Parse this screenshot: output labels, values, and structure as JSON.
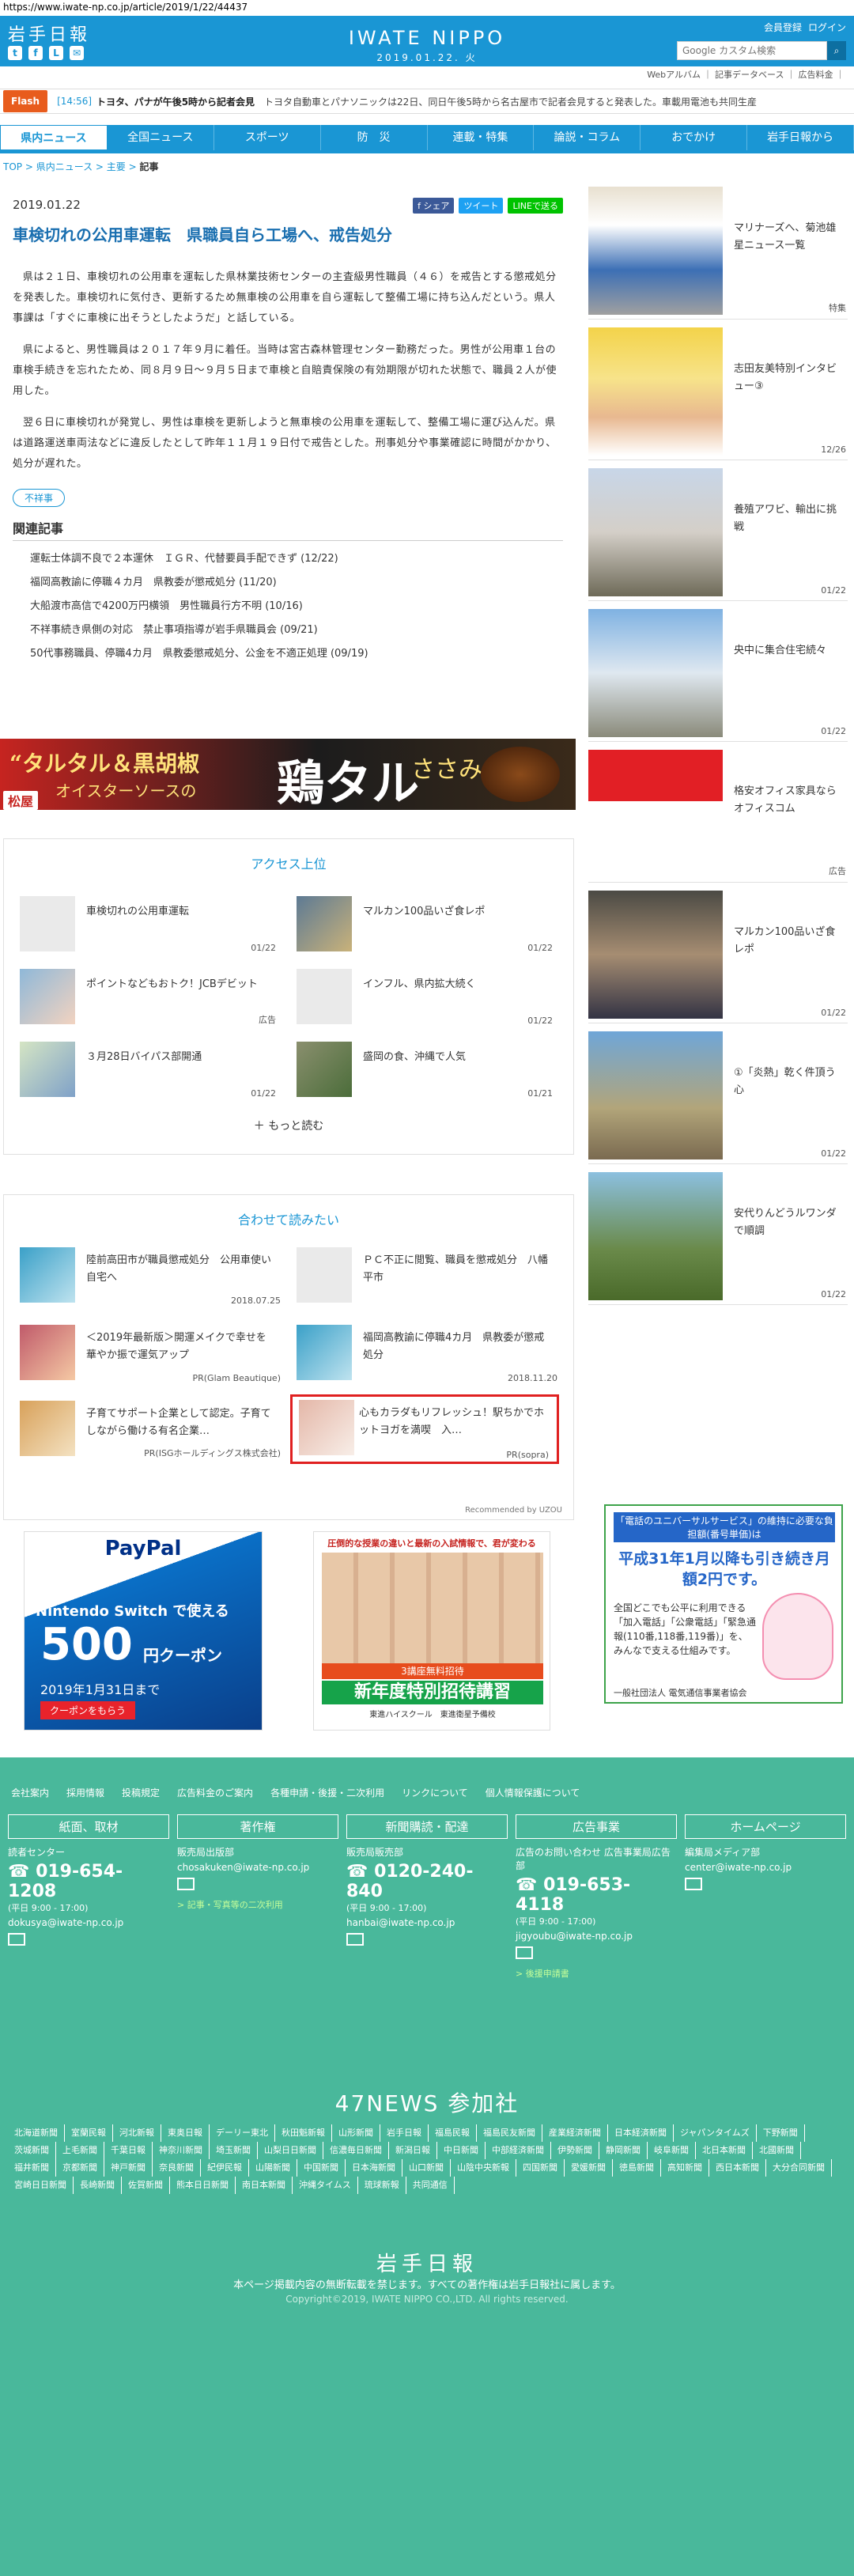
{
  "url": "https://www.iwate-np.co.jp/article/2019/1/22/44437",
  "header": {
    "logo": "岩手日報",
    "brand": "IWATE NIPPO",
    "date": "2019.01.22. 火",
    "links": [
      "会員登録",
      "ログイン"
    ],
    "search_placeholder": "Google カスタム検索",
    "subnav": "Webアルバム ｜ 記事データベース ｜ 広告料金 ｜"
  },
  "flash": {
    "label": "Flash",
    "time": "[14:56]",
    "headline": "トヨタ、パナが午後5時から記者会見",
    "text": "トヨタ自動車とパナソニックは22日、同日午後5時から名古屋市で記者会見すると発表した。車載用電池も共同生産"
  },
  "nav": [
    "県内ニュース",
    "全国ニュース",
    "スポーツ",
    "防　災",
    "連載・特集",
    "論説・コラム",
    "おでかけ",
    "岩手日報から"
  ],
  "breadcrumb": {
    "top": "TOP",
    "sep1": " > ",
    "cat": "県内ニュース",
    "sep2": " > ",
    "sub": "主要",
    "sep3": " > ",
    "current": "記事"
  },
  "article": {
    "date": "2019.01.22",
    "share": [
      "f シェア",
      "ツイート",
      "LINEで送る"
    ],
    "title": "車検切れの公用車運転　県職員自ら工場へ、戒告処分",
    "paragraphs": [
      "県は２１日、車検切れの公用車を運転した県林業技術センターの主査級男性職員（４６）を戒告とする懲戒処分を発表した。車検切れに気付き、更新するため無車検の公用車を自ら運転して整備工場に持ち込んだという。県人事課は「すぐに車検に出そうとしたようだ」と話している。",
      "県によると、男性職員は２０１７年９月に着任。当時は宮古森林管理センター勤務だった。男性が公用車１台の車検手続きを忘れたため、同８月９日～９月５日まで車検と自賠責保険の有効期限が切れた状態で、職員２人が使用した。",
      "翌６日に車検切れが発覚し、男性は車検を更新しようと無車検の公用車を運転して、整備工場に運び込んだ。県は道路運送車両法などに違反したとして昨年１１月１９日付で戒告とした。刑事処分や事業確認に時間がかかり、処分が遅れた。"
    ],
    "tag": "不祥事",
    "related_title": "関連記事",
    "related": [
      "運転士体調不良で２本運休　ＩＧＲ、代替要員手配できず (12/22)",
      "福岡高教諭に停職４カ月　県教委が懲戒処分 (11/20)",
      "大船渡市高信で4200万円横領　男性職員行方不明 (10/16)",
      "不祥事続き県側の対応　禁止事項指導が岩手県職員会 (09/21)",
      "50代事務職員、停職4カ月　県教委懲戒処分、公金を不適正処理 (09/19)"
    ]
  },
  "ad_banner": {
    "l1": "“タルタル＆黒胡椒",
    "l2": "オイスターソースの",
    "l3": "鶏タル",
    "l4": "ささみ",
    "brand": "松屋"
  },
  "access": {
    "title": "アクセス上位",
    "items": [
      {
        "text": "車検切れの公用車運転",
        "date": "01/22"
      },
      {
        "text": "マルカン100品いざ食レポ",
        "date": "01/22"
      },
      {
        "text": "ポイントなどもおトク！JCBデビット",
        "date": "広告"
      },
      {
        "text": "インフル、県内拡大続く",
        "date": "01/22"
      },
      {
        "text": "３月28日バイパス部開通",
        "date": "01/22"
      },
      {
        "text": "盛岡の食、沖縄で人気",
        "date": "01/21"
      }
    ],
    "more": "もっと読む"
  },
  "together": {
    "title": "合わせて読みたい",
    "items": [
      {
        "text": "陸前高田市が職員懲戒処分　公用車使い自宅へ",
        "date": "2018.07.25"
      },
      {
        "text": "ＰＣ不正に閲覧、職員を懲戒処分　八幡平市",
        "date": ""
      },
      {
        "text": "＜2019年最新版＞開運メイクで幸せを華やか振で運気アップ",
        "date": "PR(Glam Beautique)"
      },
      {
        "text": "福岡高教諭に停職4カ月　県教委が懲戒処分",
        "date": "2018.11.20"
      },
      {
        "text": "子育てサポート企業として認定。子育てしながら働ける有名企業…",
        "date": "PR(ISGホールディングス株式会社)"
      },
      {
        "text": "心もカラダもリフレッシュ！駅ちかでホットヨガを満喫　入…",
        "date": "PR(sopra)"
      }
    ],
    "recommend": "Recommended by UZOU"
  },
  "ad_paypal": {
    "brand": "PayPal",
    "product": "Nintendo Switch で使える",
    "amount": "500",
    "unit": "円クーポン",
    "date": "2019年1月31日まで",
    "cta": "クーポンをもらう"
  },
  "ad_school": {
    "head": "圧倒的な授業の違いと最新の入試情報で、君が変わる",
    "banner": "3講座無料招待",
    "big": "新年度特別招待講習",
    "foot": "東進ハイスクール　東進衛星予備校"
  },
  "sidebar": {
    "items": [
      {
        "text": "マリナーズへ、菊池雄星ニュース一覧",
        "date": "特集"
      },
      {
        "text": "志田友美特別インタビュー③",
        "date": "12/26"
      },
      {
        "text": "養殖アワビ、輸出に挑戦",
        "date": "01/22"
      },
      {
        "text": "央中に集合住宅続々",
        "date": "01/22"
      },
      {
        "text": "格安オフィス家具ならオフィスコム",
        "date": "広告"
      },
      {
        "text": "マルカン100品いざ食レポ",
        "date": "01/22"
      },
      {
        "text": "①「炎熱」乾く件頂う心",
        "date": "01/22"
      },
      {
        "text": "安代りんどうルワンダで順調",
        "date": "01/22"
      }
    ],
    "ad": {
      "t1": "「電話のユニバーサルサービス」の維持に必要な負担額(番号単価)は",
      "t2": "平成31年1月以降も引き続き月額2円です。",
      "t3": "全国どこでも公平に利用できる「加入電話」「公衆電話」「緊急通報(110番,118番,119番)」を、みんなで支える仕組みです。",
      "t4": "一般社団法人 電気通信事業者協会"
    }
  },
  "footer": {
    "links": [
      "会社案内",
      "採用情報",
      "投稿規定",
      "広告料金のご案内",
      "各種申請・後援・二次利用",
      "リンクについて",
      "個人情報保護について"
    ],
    "cols": [
      {
        "head": "紙面、取材",
        "sub": "読者センター",
        "tel": "019-654-1208",
        "hours": "(平日 9:00 - 17:00)",
        "mail": "dokusya@iwate-np.co.jp",
        "link": ""
      },
      {
        "head": "著作権",
        "sub": "販売局出版部",
        "tel": "",
        "hours": "",
        "mail": "chosakuken@iwate-np.co.jp",
        "link": "> 記事・写真等の二次利用"
      },
      {
        "head": "新聞購読・配達",
        "sub": "販売局販売部",
        "tel": "0120-240-840",
        "hours": "(平日 9:00 - 17:00)",
        "mail": "hanbai@iwate-np.co.jp",
        "link": ""
      },
      {
        "head": "広告事業",
        "sub": "広告のお問い合わせ 広告事業局広告部",
        "tel": "019-653-4118",
        "hours": "(平日 9:00 - 17:00)",
        "mail": "jigyoubu@iwate-np.co.jp",
        "link": "> 後援申請書"
      },
      {
        "head": "ホームページ",
        "sub": "編集局メディア部",
        "tel": "",
        "hours": "",
        "mail": "center@iwate-np.co.jp",
        "link": ""
      }
    ],
    "news47": "47NEWS 参加社",
    "papers": [
      "北海道新聞",
      "室蘭民報",
      "河北新報",
      "東奥日報",
      "デーリー東北",
      "秋田魁新報",
      "山形新聞",
      "岩手日報",
      "福島民報",
      "福島民友新聞",
      "産業経済新聞",
      "日本経済新聞",
      "ジャパンタイムズ",
      "下野新聞",
      "茨城新聞",
      "上毛新聞",
      "千葉日報",
      "神奈川新聞",
      "埼玉新聞",
      "山梨日日新聞",
      "信濃毎日新聞",
      "新潟日報",
      "中日新聞",
      "中部経済新聞",
      "伊勢新聞",
      "静岡新聞",
      "岐阜新聞",
      "北日本新聞",
      "北國新聞",
      "福井新聞",
      "京都新聞",
      "神戸新聞",
      "奈良新聞",
      "紀伊民報",
      "山陽新聞",
      "中国新聞",
      "日本海新聞",
      "山口新聞",
      "山陰中央新報",
      "四国新聞",
      "愛媛新聞",
      "徳島新聞",
      "高知新聞",
      "西日本新聞",
      "大分合同新聞",
      "宮崎日日新聞",
      "長崎新聞",
      "佐賀新聞",
      "熊本日日新聞",
      "南日本新聞",
      "沖縄タイムス",
      "琉球新報",
      "共同通信"
    ],
    "logo": "岩手日報",
    "notice": "本ページ掲載内容の無断転載を禁じます。すべての著作権は岩手日報社に属します。",
    "copyright": "Copyright©2019, IWATE NIPPO CO.,LTD. All rights reserved."
  }
}
